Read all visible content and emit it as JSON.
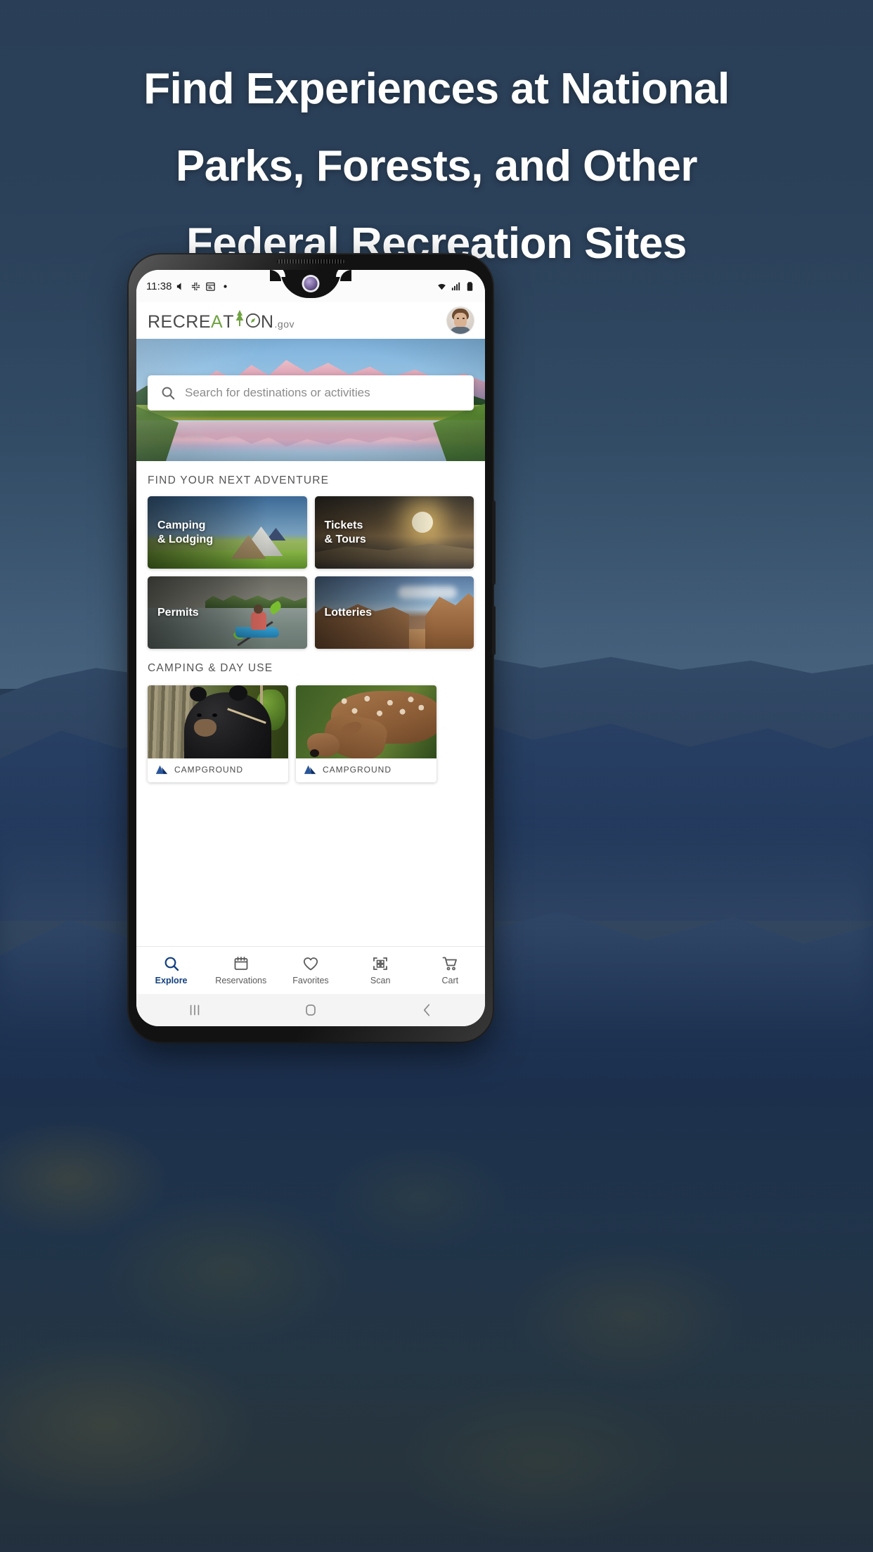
{
  "headline": {
    "line1": "Find Experiences at National",
    "line2": "Parks, Forests, and Other",
    "line3": "Federal Recreation Sites",
    "color": "#ffffff"
  },
  "background": {
    "scene": "blue-mountain-landscape",
    "tint": "#2b4059"
  },
  "phone": {
    "status_bar": {
      "time": "11:38",
      "left_icons": [
        "volume-mute-icon",
        "slack-icon",
        "calendar-icon",
        "dot-icon"
      ],
      "right_icons": [
        "wifi-icon",
        "signal-icon",
        "battery-icon"
      ]
    },
    "system_nav": {
      "recents_label": "recents-icon",
      "home_label": "home-icon",
      "back_label": "back-icon"
    }
  },
  "app": {
    "logo": {
      "part1": "RECRE",
      "part2": "A",
      "part3": "T",
      "part4": "N",
      "suffix": ".gov",
      "green": "#6fa342",
      "dark": "#4a4a4a"
    },
    "avatar_name": "user-avatar",
    "search": {
      "placeholder": "Search for destinations or activities",
      "value": ""
    },
    "sections": [
      {
        "title": "FIND YOUR NEXT ADVENTURE"
      },
      {
        "title": "CAMPING & DAY USE"
      }
    ],
    "categories": [
      {
        "label": "Camping\n& Lodging",
        "art": "tent-campsite"
      },
      {
        "label": "Tickets\n& Tours",
        "art": "sunset-dunes"
      },
      {
        "label": "Permits",
        "art": "kayaker-river"
      },
      {
        "label": "Lotteries",
        "art": "red-rock-canyon"
      }
    ],
    "camping_cards": [
      {
        "type": "CAMPGROUND",
        "art": "black-bear"
      },
      {
        "type": "CAMPGROUND",
        "art": "spotted-fawn"
      }
    ],
    "bottom_nav": {
      "active_index": 0,
      "active_color": "#12407e",
      "items": [
        {
          "label": "Explore",
          "icon": "search-icon"
        },
        {
          "label": "Reservations",
          "icon": "calendar-icon"
        },
        {
          "label": "Favorites",
          "icon": "heart-icon"
        },
        {
          "label": "Scan",
          "icon": "qr-scan-icon"
        },
        {
          "label": "Cart",
          "icon": "shopping-cart-icon"
        }
      ]
    }
  }
}
